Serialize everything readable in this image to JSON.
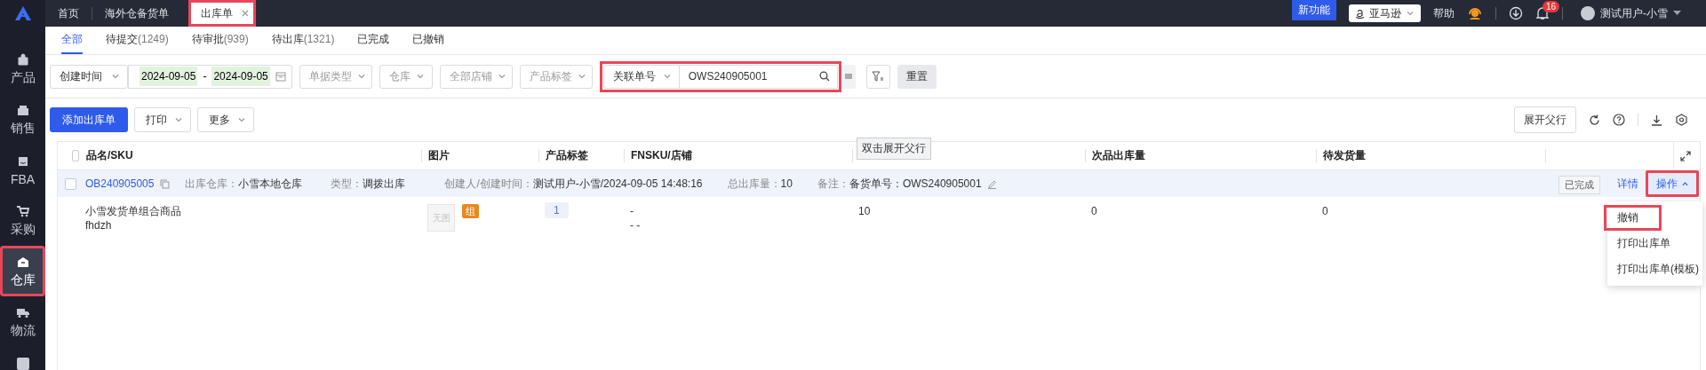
{
  "sidebar": {
    "items": [
      {
        "label": "产品",
        "selected": false,
        "highlighted": false
      },
      {
        "label": "销售",
        "selected": false,
        "highlighted": false
      },
      {
        "label": "FBA",
        "selected": false,
        "highlighted": false
      },
      {
        "label": "采购",
        "selected": false,
        "highlighted": false
      },
      {
        "label": "仓库",
        "selected": true,
        "highlighted": true
      },
      {
        "label": "物流",
        "selected": false,
        "highlighted": false
      }
    ]
  },
  "top_tabs": [
    {
      "label": "首页",
      "selected": false,
      "closable": false,
      "highlighted": false
    },
    {
      "label": "海外仓备货单",
      "selected": false,
      "closable": false,
      "highlighted": false
    },
    {
      "label": "出库单",
      "selected": true,
      "closable": true,
      "highlighted": true
    }
  ],
  "header": {
    "new_feature": "新功能",
    "marketplace": "亚马逊",
    "help": "帮助",
    "notification_count": "16",
    "user": "测试用户-小雪"
  },
  "status_tabs": [
    {
      "label": "全部",
      "selected": true
    },
    {
      "label": "待提交",
      "count": "(1249)",
      "selected": false
    },
    {
      "label": "待审批",
      "count": "(939)",
      "selected": false
    },
    {
      "label": "待出库",
      "count": "(1321)",
      "selected": false
    },
    {
      "label": "已完成",
      "selected": false
    },
    {
      "label": "已撤销",
      "selected": false
    }
  ],
  "filters": [
    {
      "kind": "select",
      "value": "创建时间"
    },
    {
      "kind": "daterange",
      "start": "2024-09-05",
      "separator": "-",
      "end": "2024-09-05"
    },
    {
      "kind": "select",
      "placeholder": "单据类型"
    },
    {
      "kind": "select",
      "placeholder": "仓库"
    },
    {
      "kind": "select",
      "placeholder": "全部店铺"
    },
    {
      "kind": "select",
      "placeholder": "产品标签"
    },
    {
      "kind": "search",
      "field": "关联单号",
      "value": "OWS240905001",
      "highlighted": true
    }
  ],
  "reset_button": "重置",
  "actions": {
    "primary": "添加出库单",
    "dropdowns": [
      "打印",
      "更多"
    ],
    "expand_parent": "展开父行"
  },
  "table": {
    "all_checked": false,
    "columns": [
      {
        "label": "品名/SKU"
      },
      {
        "label": "图片"
      },
      {
        "label": "产品标签"
      },
      {
        "label": "FNSKU/店铺"
      },
      {
        "tooltip": "双击展开父行"
      },
      {
        "label": "次品出库量"
      },
      {
        "label": "待发货量"
      }
    ],
    "orders": [
      {
        "checked": false,
        "id": "OB240905005",
        "fields": [
          {
            "label": "出库仓库：",
            "value": "小雪本地仓库"
          },
          {
            "label": "类型：",
            "value": "调拨出库"
          },
          {
            "label": "创建人/创建时间：",
            "value": "测试用户-小雪/2024-09-05 14:48:16"
          },
          {
            "label": "总出库量：",
            "value": "10"
          },
          {
            "label": "备注：",
            "value": "备货单号：OWS240905001"
          }
        ],
        "status": "已完成",
        "detail_link": "详情",
        "ops_button": "操作",
        "ops_expanded": true,
        "ops_highlighted": true,
        "menu": [
          {
            "label": "撤销",
            "highlighted": true
          },
          {
            "label": "打印出库单",
            "highlighted": false
          },
          {
            "label": "打印出库单(模板)",
            "highlighted": false
          }
        ],
        "items": [
          {
            "name": "小雪发货单组合商品",
            "sku": "fhdzh",
            "image_placeholder": "无图",
            "tag": "组",
            "label_count": "1",
            "fnsku": "-",
            "shop": "- -",
            "qty": "10",
            "defect_qty": "0",
            "pending_qty": "0"
          }
        ]
      }
    ]
  }
}
